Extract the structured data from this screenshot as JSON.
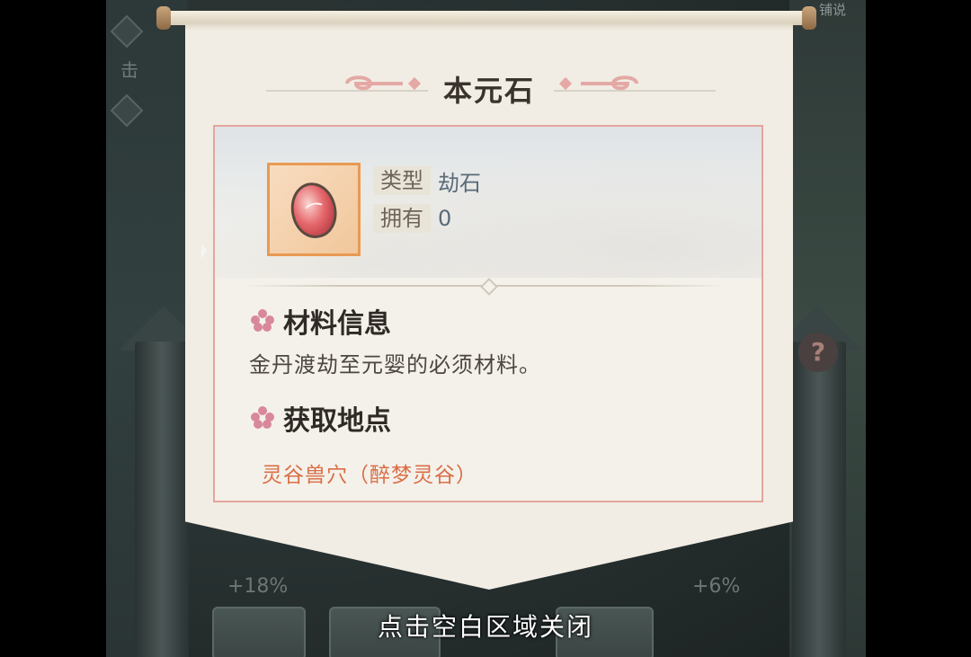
{
  "background": {
    "left_label": "击",
    "top_right_label": "铺说",
    "stat_left": "+18%",
    "stat_right": "+6%",
    "help_icon": "question-icon"
  },
  "dialog": {
    "title": "本元石",
    "item": {
      "icon": "red-stone-egg-icon",
      "type_label": "类型",
      "type_value": "劫石",
      "owned_label": "拥有",
      "owned_value": "0"
    },
    "material_info": {
      "heading": "材料信息",
      "description": "金丹渡劫至元婴的必须材料。"
    },
    "obtain": {
      "heading": "获取地点",
      "sources": [
        "灵谷兽穴（醉梦灵谷）"
      ]
    }
  },
  "close_hint": "点击空白区域关闭",
  "colors": {
    "panel": "#f1ede4",
    "border_accent": "#e3a59e",
    "item_frame": "#e89a52",
    "link": "#d96e46",
    "flower": "#d8889a"
  }
}
